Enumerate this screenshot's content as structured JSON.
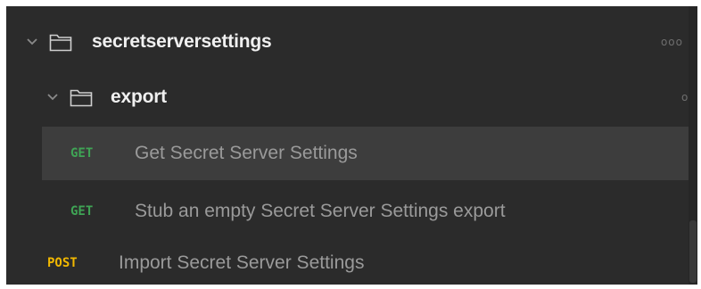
{
  "collection": {
    "folders": [
      {
        "name": "secretserversettings",
        "more": "ooo"
      },
      {
        "name": "export",
        "more": "ooo"
      }
    ],
    "requests": [
      {
        "method": "GET",
        "name": "Get Secret Server Settings"
      },
      {
        "method": "GET",
        "name": "Stub an empty Secret Server Settings export"
      },
      {
        "method": "POST",
        "name": "Import Secret Server Settings"
      }
    ]
  },
  "colors": {
    "panel_background": "#2b2b2b",
    "selected_row": "#3d3d3d",
    "get_method": "#3fa455",
    "post_method": "#f2b800"
  }
}
